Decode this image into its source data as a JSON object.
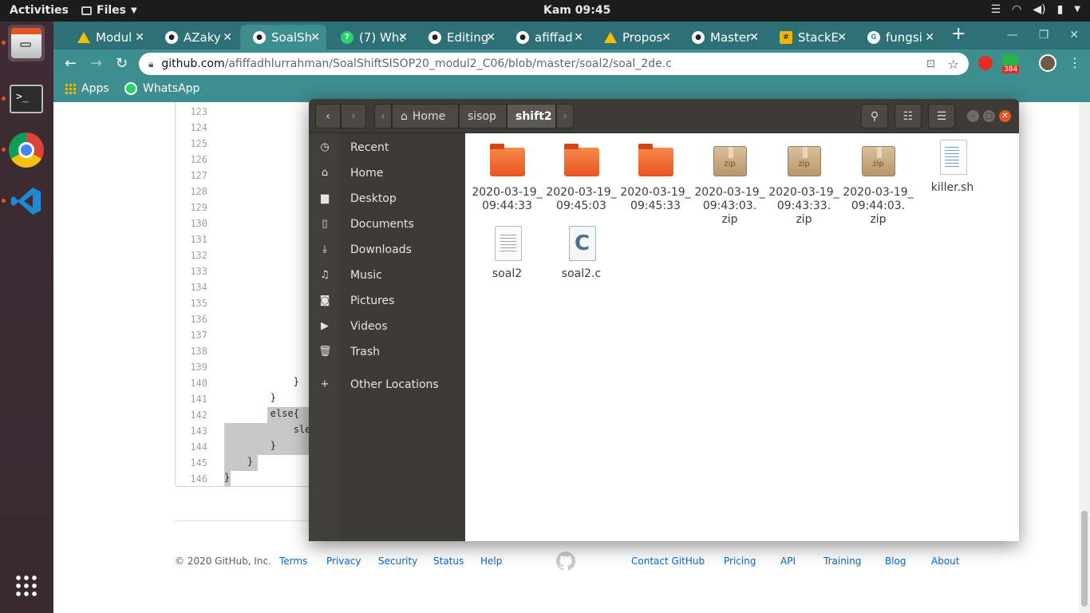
{
  "topbar": {
    "activities": "Activities",
    "app_menu": "Files",
    "clock": "Kam 09:45"
  },
  "dock": {
    "items": [
      "files-app",
      "terminal",
      "chrome",
      "vscode"
    ],
    "apps_grid": "show-applications"
  },
  "browser": {
    "tabs": [
      {
        "label": "Modul",
        "icon": "drive-icon"
      },
      {
        "label": "AZaky",
        "icon": "github-icon"
      },
      {
        "label": "SoalSh",
        "icon": "github-icon",
        "active": true
      },
      {
        "label": "(7) Wha",
        "icon": "whatsapp-icon"
      },
      {
        "label": "Editing",
        "icon": "github-icon"
      },
      {
        "label": "afiffad",
        "icon": "github-icon"
      },
      {
        "label": "Propos",
        "icon": "drive-icon"
      },
      {
        "label": "Master",
        "icon": "github-icon"
      },
      {
        "label": "StackE",
        "icon": "stackedit-icon"
      },
      {
        "label": "fungsi",
        "icon": "google-icon"
      }
    ],
    "url_host": "github.com",
    "url_path": "/afiffadhlurrahman/SoalShiftSISOP20_modul2_C06/blob/master/soal2/soal_2de.c",
    "extension_badge": "384",
    "bookmarks": [
      {
        "label": "Apps",
        "icon": "apps-grid-icon"
      },
      {
        "label": "WhatsApp",
        "icon": "whatsapp-icon"
      }
    ]
  },
  "code": {
    "lines": [
      {
        "num": "123",
        "text": ""
      },
      {
        "num": "124",
        "text": ""
      },
      {
        "num": "125",
        "text": ""
      },
      {
        "num": "126",
        "text": ""
      },
      {
        "num": "127",
        "text": ""
      },
      {
        "num": "128",
        "text": ""
      },
      {
        "num": "129",
        "text": ""
      },
      {
        "num": "130",
        "text": ""
      },
      {
        "num": "131",
        "text": ""
      },
      {
        "num": "132",
        "text": ""
      },
      {
        "num": "133",
        "text": ""
      },
      {
        "num": "134",
        "text": ""
      },
      {
        "num": "135",
        "text": ""
      },
      {
        "num": "136",
        "text": ""
      },
      {
        "num": "137",
        "text": ""
      },
      {
        "num": "138",
        "text": ""
      },
      {
        "num": "139",
        "text": ""
      },
      {
        "num": "140",
        "text": "            }"
      },
      {
        "num": "141",
        "text": "        }"
      },
      {
        "num": "142",
        "text": "        else{"
      },
      {
        "num": "143",
        "text": "            sle"
      },
      {
        "num": "144",
        "text": "        }"
      },
      {
        "num": "145",
        "text": "    }"
      },
      {
        "num": "146",
        "text": "}"
      }
    ]
  },
  "footer": {
    "copyright": "© 2020 GitHub, Inc.",
    "left_links": [
      "Terms",
      "Privacy",
      "Security",
      "Status",
      "Help"
    ],
    "right_links": [
      "Contact GitHub",
      "Pricing",
      "API",
      "Training",
      "Blog",
      "About"
    ]
  },
  "nautilus": {
    "breadcrumbs": [
      "Home",
      "sisop",
      "shift2"
    ],
    "sidebar": [
      {
        "label": "Recent",
        "icon": "clock-icon"
      },
      {
        "label": "Home",
        "icon": "home-icon"
      },
      {
        "label": "Desktop",
        "icon": "folder-icon"
      },
      {
        "label": "Documents",
        "icon": "document-icon"
      },
      {
        "label": "Downloads",
        "icon": "download-icon"
      },
      {
        "label": "Music",
        "icon": "music-icon"
      },
      {
        "label": "Pictures",
        "icon": "camera-icon"
      },
      {
        "label": "Videos",
        "icon": "video-icon"
      },
      {
        "label": "Trash",
        "icon": "trash-icon"
      },
      {
        "label": "Other Locations",
        "icon": "plus-icon"
      }
    ],
    "files": [
      {
        "name_line1": "2020-03-19_",
        "name_line2": "09:44:33",
        "name_line3": "",
        "type": "folder"
      },
      {
        "name_line1": "2020-03-19_",
        "name_line2": "09:45:03",
        "name_line3": "",
        "type": "folder"
      },
      {
        "name_line1": "2020-03-19_",
        "name_line2": "09:45:33",
        "name_line3": "",
        "type": "folder"
      },
      {
        "name_line1": "2020-03-19_",
        "name_line2": "09:43:03.",
        "name_line3": "zip",
        "type": "zip"
      },
      {
        "name_line1": "2020-03-19_",
        "name_line2": "09:43:33.",
        "name_line3": "zip",
        "type": "zip"
      },
      {
        "name_line1": "2020-03-19_",
        "name_line2": "09:44:03.",
        "name_line3": "zip",
        "type": "zip"
      },
      {
        "name_line1": "killer.sh",
        "name_line2": "",
        "name_line3": "",
        "type": "script"
      },
      {
        "name_line1": "soal2",
        "name_line2": "",
        "name_line3": "",
        "type": "binary"
      },
      {
        "name_line1": "soal2.c",
        "name_line2": "",
        "name_line3": "",
        "type": "c-source"
      }
    ],
    "zip_label": "zip"
  }
}
